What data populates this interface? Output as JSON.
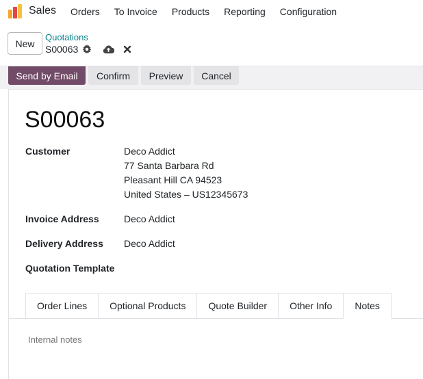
{
  "navbar": {
    "app_name": "Sales",
    "menu": [
      "Orders",
      "To Invoice",
      "Products",
      "Reporting",
      "Configuration"
    ],
    "logo_colors": [
      "#f7a42e",
      "#e0474c",
      "#8b5aa8"
    ]
  },
  "control_panel": {
    "new_label": "New",
    "breadcrumb": "Quotations",
    "record_name": "S00063",
    "icons": [
      "gear-icon",
      "cloud-upload-icon",
      "close-icon"
    ]
  },
  "actions": {
    "send_by_email": "Send by Email",
    "confirm": "Confirm",
    "preview": "Preview",
    "cancel": "Cancel",
    "primary_color": "#714b67"
  },
  "form": {
    "title": "S00063",
    "customer_label": "Customer",
    "customer_lines": [
      "Deco Addict",
      "77 Santa Barbara Rd",
      "Pleasant Hill CA 94523",
      "United States – US12345673"
    ],
    "invoice_address_label": "Invoice Address",
    "invoice_address_value": "Deco Addict",
    "delivery_address_label": "Delivery Address",
    "delivery_address_value": "Deco Addict",
    "quotation_template_label": "Quotation Template",
    "quotation_template_value": ""
  },
  "tabs": {
    "items": [
      "Order Lines",
      "Optional Products",
      "Quote Builder",
      "Other Info",
      "Notes"
    ],
    "active": "Notes"
  },
  "notes": {
    "placeholder": "Internal notes"
  }
}
